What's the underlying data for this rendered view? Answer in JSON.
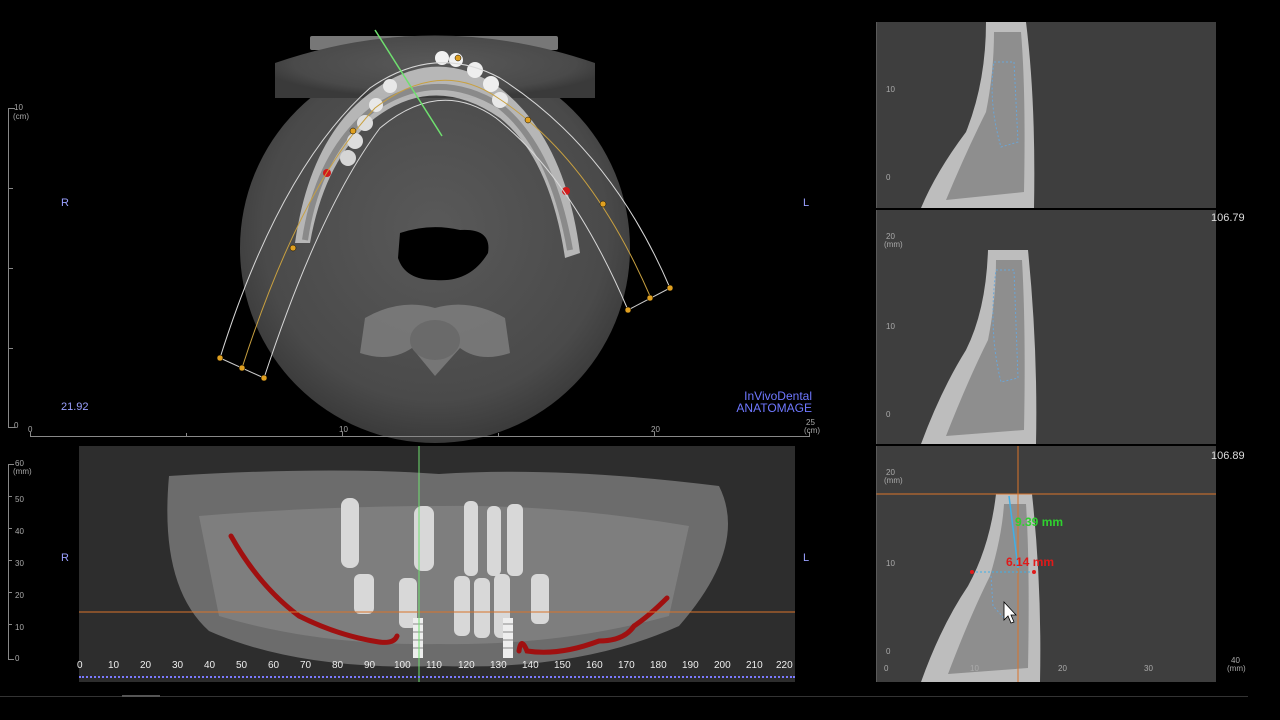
{
  "axial": {
    "orient_left": "R",
    "orient_right": "L",
    "slice_value": "21.92",
    "watermark_line1": "InVivoDental",
    "watermark_line2": "ANATOMAGE",
    "vruler_top": "10",
    "vruler_unit": "(cm)",
    "vruler_bottom": "0",
    "hruler_labels": [
      "0",
      "10",
      "20",
      "25"
    ],
    "hruler_unit": "(cm)"
  },
  "panoramic": {
    "orient_left": "R",
    "orient_right": "L",
    "vruler_labels": [
      "60",
      "50",
      "40",
      "30",
      "20",
      "10",
      "0"
    ],
    "vruler_unit": "(mm)",
    "scale_labels": [
      "0",
      "10",
      "20",
      "30",
      "40",
      "50",
      "60",
      "70",
      "80",
      "90",
      "100",
      "110",
      "120",
      "130",
      "140",
      "150",
      "160",
      "170",
      "180",
      "190",
      "200",
      "210",
      "220"
    ]
  },
  "cross_sections": [
    {
      "value": "",
      "vlabels": [
        "10",
        "0"
      ],
      "unit": ""
    },
    {
      "value": "106.79",
      "vlabels": [
        "20",
        "10",
        "0"
      ],
      "unit": "(mm)"
    },
    {
      "value": "106.89",
      "vlabels": [
        "20",
        "10",
        "0"
      ],
      "unit": "(mm)"
    }
  ],
  "cross_bottom_scale": [
    "0",
    "10",
    "20",
    "30",
    "40"
  ],
  "cross_bottom_unit": "(mm)",
  "measurements": {
    "height": "9.39 mm",
    "width": "6.14 mm"
  },
  "colors": {
    "nerve": "#a01010",
    "cursor_line": "#6fe06f",
    "ref_line": "#d9742a",
    "arch_curve": "#c8a040",
    "measure_green": "#2fd12f",
    "measure_red": "#e01a1a"
  }
}
